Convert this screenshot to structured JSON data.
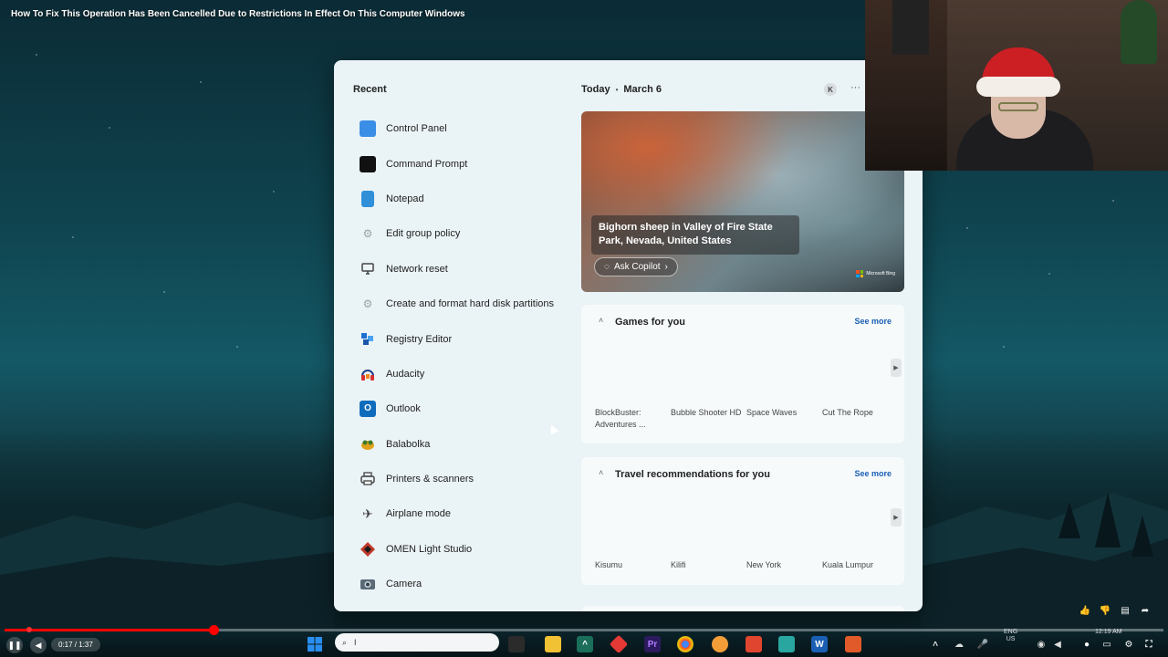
{
  "video": {
    "title": "How To Fix This Operation Has Been Cancelled Due to Restrictions In Effect On This Computer Windows",
    "time": "0:17 / 1:37",
    "progress_fraction": 0.18
  },
  "start_menu": {
    "recent_heading": "Recent",
    "recent_items": [
      {
        "label": "Control Panel",
        "icon": "control-panel-icon",
        "color": "#3a8ee6"
      },
      {
        "label": "Command Prompt",
        "icon": "command-prompt-icon",
        "color": "#111111"
      },
      {
        "label": "Notepad",
        "icon": "notepad-icon",
        "color": "#2f8fd8"
      },
      {
        "label": "Edit group policy",
        "icon": "gear-icon",
        "color": "#9aa3a8"
      },
      {
        "label": "Network reset",
        "icon": "monitor-icon",
        "color": "#444444"
      },
      {
        "label": "Create and format hard disk partitions",
        "icon": "gear-icon",
        "color": "#9aa3a8"
      },
      {
        "label": "Registry Editor",
        "icon": "registry-editor-icon",
        "color": "#1e6fd1"
      },
      {
        "label": "Audacity",
        "icon": "audacity-icon",
        "color": "#d8302f"
      },
      {
        "label": "Outlook",
        "icon": "outlook-icon",
        "color": "#0f6cbd"
      },
      {
        "label": "Balabolka",
        "icon": "balabolka-icon",
        "color": "#e0a21c"
      },
      {
        "label": "Printers & scanners",
        "icon": "printer-icon",
        "color": "#444444"
      },
      {
        "label": "Airplane mode",
        "icon": "airplane-icon",
        "color": "#444444"
      },
      {
        "label": "OMEN Light Studio",
        "icon": "omen-icon",
        "color": "#c0392b"
      },
      {
        "label": "Camera",
        "icon": "camera-icon",
        "color": "#5a6b78"
      }
    ],
    "today": {
      "label": "Today",
      "date": "March 6",
      "avatar_letter": "K",
      "more": "···"
    },
    "hero": {
      "caption": "Bighorn sheep in Valley of Fire State Park, Nevada, United States",
      "ask_copilot": "Ask Copilot",
      "logo_text": "Microsoft Bing"
    },
    "games_card": {
      "title": "Games for you",
      "see_more": "See more",
      "items": [
        "BlockBuster: Adventures ...",
        "Bubble Shooter HD",
        "Space Waves",
        "Cut The Rope"
      ]
    },
    "travel_card": {
      "title": "Travel recommendations for you",
      "see_more": "See more",
      "items": [
        "Kisumu",
        "Kilifi",
        "New York",
        "Kuala Lumpur"
      ]
    }
  },
  "taskbar": {
    "search_value": "I",
    "language": "ENG",
    "region": "US",
    "clock": "12:19 AM"
  }
}
